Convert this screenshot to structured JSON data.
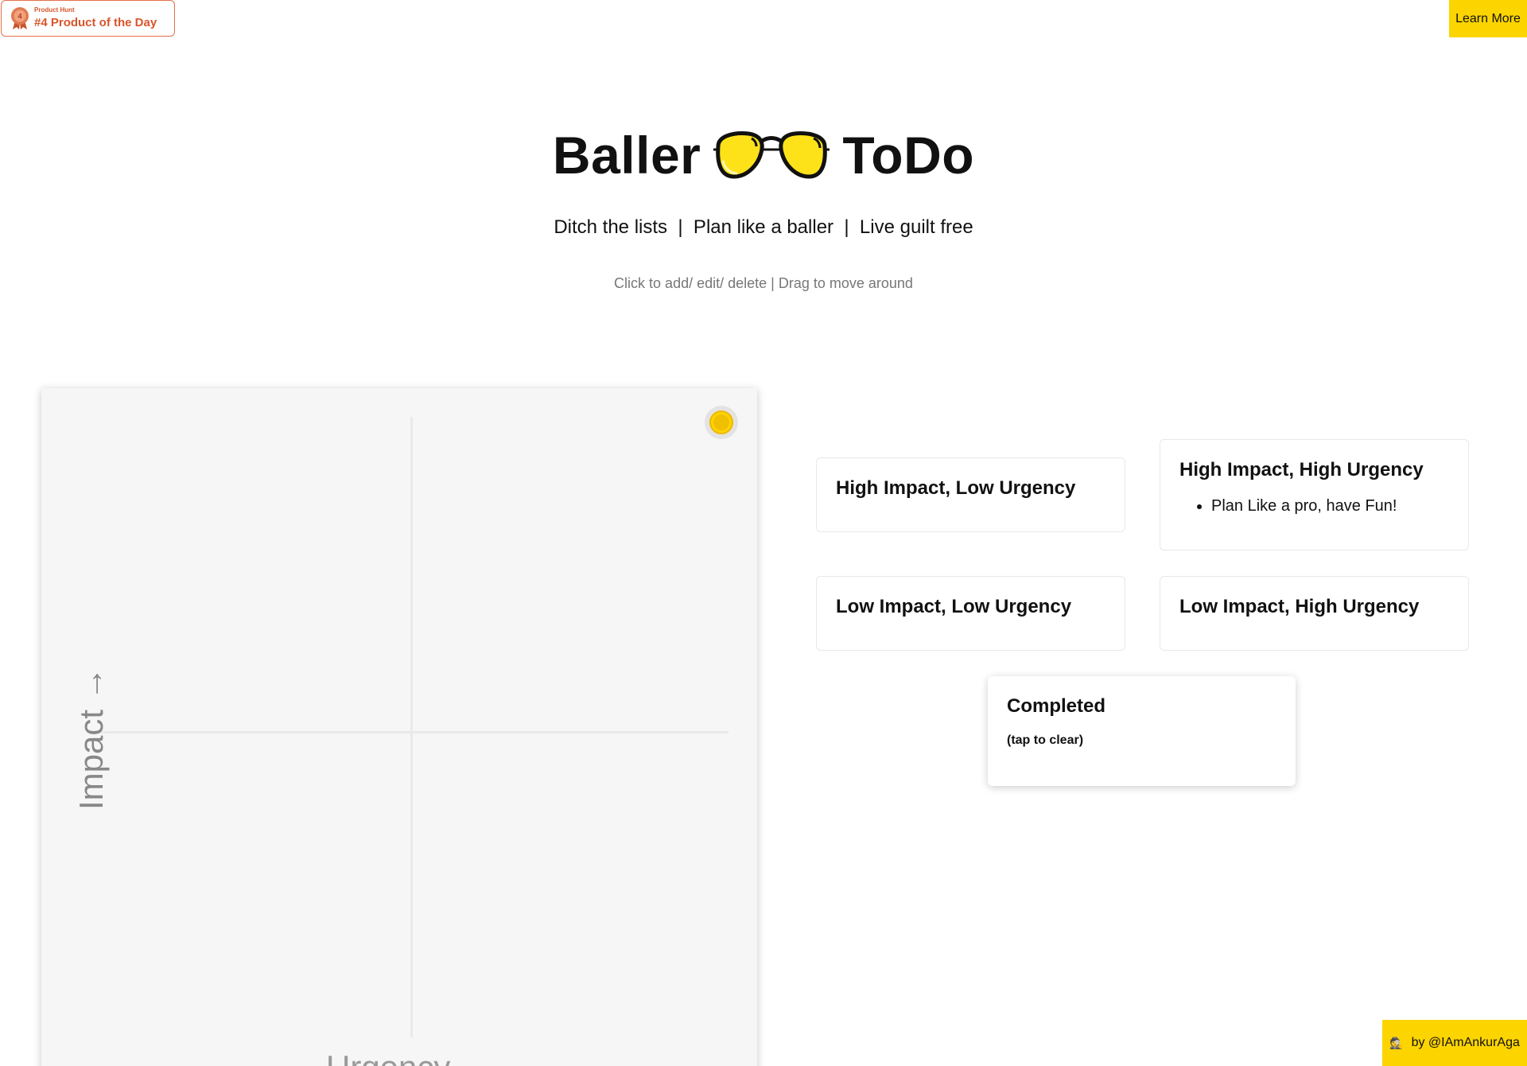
{
  "badge": {
    "small_label": "Product Hunt",
    "big_label": "#4 Product of the Day"
  },
  "header": {
    "learn_more_label": "Learn More"
  },
  "hero": {
    "title_left": "Baller",
    "title_right": "ToDo",
    "tagline": "Ditch the lists  |  Plan like a baller  |  Live guilt free",
    "hint": "Click to add/ edit/ delete | Drag to move around"
  },
  "board": {
    "y_axis_label": "Impact →",
    "x_axis_label": "Urgency"
  },
  "quadrants": {
    "high_low": {
      "title": "High Impact, Low Urgency",
      "items": []
    },
    "high_high": {
      "title": "High Impact, High Urgency",
      "items": [
        "Plan Like a pro, have Fun!"
      ]
    },
    "low_low": {
      "title": "Low Impact, Low Urgency",
      "items": []
    },
    "low_high": {
      "title": "Low Impact, High Urgency",
      "items": []
    }
  },
  "completed": {
    "title": "Completed",
    "subtitle": "(tap to clear)"
  },
  "footer": {
    "emoji": "🕵️",
    "credit": "by  @IAmAnkurAga"
  },
  "colors": {
    "accent_yellow": "#fcd400",
    "product_hunt_orange": "#d9552c"
  }
}
